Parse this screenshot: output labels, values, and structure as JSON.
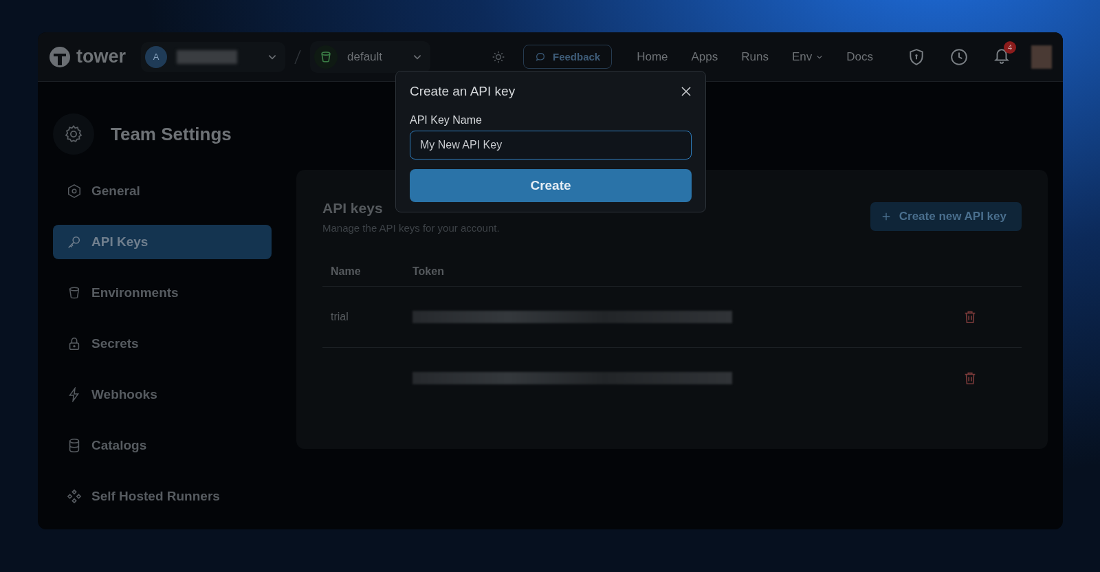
{
  "brand": {
    "name": "tower"
  },
  "team_switcher": {
    "avatar_letter": "A"
  },
  "environment_switcher": {
    "label": "default"
  },
  "feedback_button": {
    "label": "Feedback"
  },
  "nav": [
    {
      "label": "Home",
      "kind": "link"
    },
    {
      "label": "Apps",
      "kind": "link"
    },
    {
      "label": "Runs",
      "kind": "link"
    },
    {
      "label": "Env",
      "kind": "dropdown"
    },
    {
      "label": "Docs",
      "kind": "link"
    }
  ],
  "notifications": {
    "count": "4"
  },
  "sidebar": {
    "title": "Team Settings",
    "items": [
      {
        "label": "General",
        "selected": false
      },
      {
        "label": "API Keys",
        "selected": true
      },
      {
        "label": "Environments",
        "selected": false
      },
      {
        "label": "Secrets",
        "selected": false
      },
      {
        "label": "Webhooks",
        "selected": false
      },
      {
        "label": "Catalogs",
        "selected": false
      },
      {
        "label": "Self Hosted Runners",
        "selected": false
      }
    ]
  },
  "api_keys": {
    "title": "API keys",
    "subtitle": "Manage the API keys for your account.",
    "create_button": "Create new API key",
    "columns": [
      "Name",
      "Token"
    ],
    "rows": [
      {
        "name": "trial"
      },
      {}
    ]
  },
  "dialog": {
    "title": "Create an API key",
    "field_label": "API Key Name",
    "field_value": "My New API Key",
    "submit": "Create"
  }
}
